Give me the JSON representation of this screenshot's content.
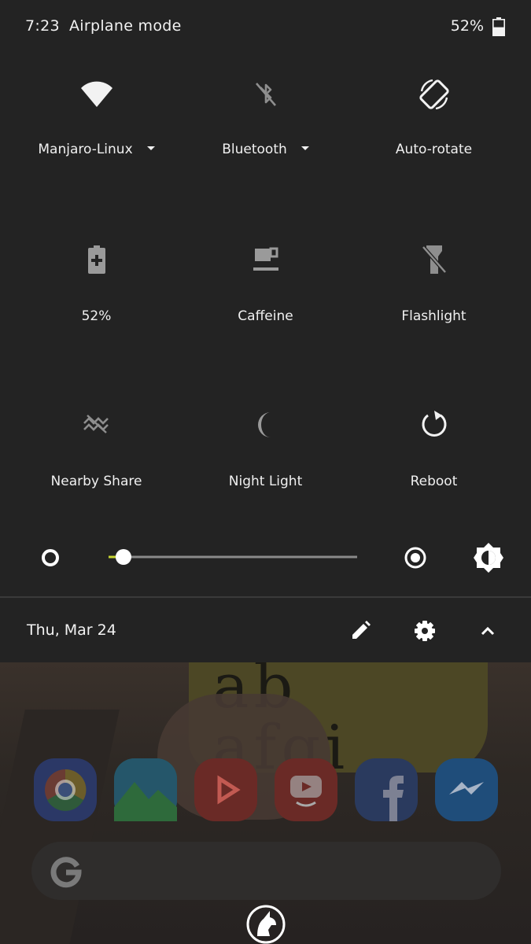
{
  "status_bar": {
    "time": "7:23",
    "mode": "Airplane mode",
    "battery_percent": "52%",
    "battery_level": 0.52
  },
  "tiles": [
    {
      "label": "Manjaro-Linux",
      "icon": "wifi-icon",
      "has_dropdown": true
    },
    {
      "label": "Bluetooth",
      "icon": "bluetooth-off-icon",
      "has_dropdown": true
    },
    {
      "label": "Auto-rotate",
      "icon": "auto-rotate-icon",
      "has_dropdown": false
    },
    {
      "label": "52%",
      "icon": "battery-saver-icon",
      "has_dropdown": false
    },
    {
      "label": "Caffeine",
      "icon": "coffee-cup-icon",
      "has_dropdown": false
    },
    {
      "label": "Flashlight",
      "icon": "flashlight-off-icon",
      "has_dropdown": false
    },
    {
      "label": "Nearby Share",
      "icon": "nearby-share-icon",
      "has_dropdown": false
    },
    {
      "label": "Night Light",
      "icon": "moon-icon",
      "has_dropdown": false
    },
    {
      "label": "Reboot",
      "icon": "reboot-icon",
      "has_dropdown": false
    }
  ],
  "brightness": {
    "level": 0.06,
    "accent_color": "#c6d531",
    "track_color": "#8a8a8a"
  },
  "footer": {
    "date": "Thu, Mar 24",
    "edit_icon": "pencil-icon",
    "settings_icon": "gear-icon",
    "collapse_icon": "chevron-up-icon"
  },
  "home": {
    "apps": [
      {
        "name": "chrome-app-icon",
        "color": "#2b3866"
      },
      {
        "name": "gallery-app-icon",
        "color": "#1f5a4a"
      },
      {
        "name": "youtube-music-app-icon",
        "color": "#6a2a26"
      },
      {
        "name": "youtube-kids-app-icon",
        "color": "#6a2a26"
      },
      {
        "name": "facebook-app-icon",
        "color": "#2a3a5e"
      },
      {
        "name": "messenger-app-icon",
        "color": "#1f4d7a"
      }
    ]
  }
}
